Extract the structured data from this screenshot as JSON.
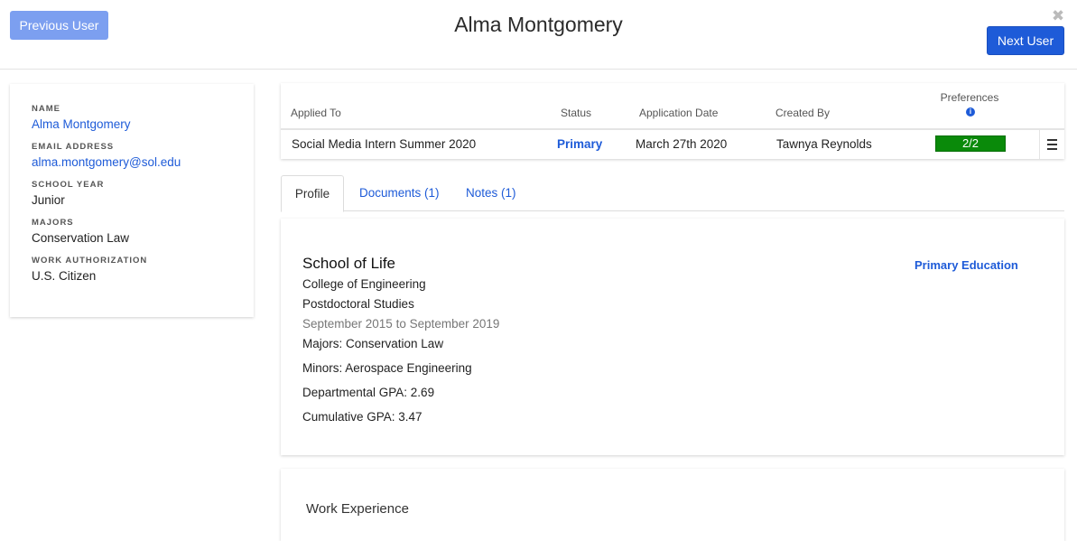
{
  "header": {
    "prev_label": "Previous User",
    "title": "Alma Montgomery",
    "close_glyph": "✖",
    "next_label": "Next User"
  },
  "sidebar": {
    "fields": [
      {
        "label": "NAME",
        "value": "Alma Montgomery",
        "is_link": true
      },
      {
        "label": "EMAIL ADDRESS",
        "value": "alma.montgomery@sol.edu",
        "is_link": true
      },
      {
        "label": "SCHOOL YEAR",
        "value": "Junior",
        "is_link": false
      },
      {
        "label": "MAJORS",
        "value": "Conservation Law",
        "is_link": false
      },
      {
        "label": "WORK AUTHORIZATION",
        "value": "U.S. Citizen",
        "is_link": false
      }
    ]
  },
  "applications": {
    "columns": {
      "applied_to": "Applied To",
      "status": "Status",
      "application_date": "Application Date",
      "created_by": "Created By",
      "preferences": "Preferences"
    },
    "row": {
      "applied_to": "Social Media Intern Summer 2020",
      "status": "Primary",
      "application_date": "March 27th 2020",
      "created_by": "Tawnya Reynolds",
      "preferences": "2/2"
    },
    "info_icon": "info-icon",
    "menu_icon": "hamburger-menu-icon"
  },
  "tabs": [
    {
      "label": "Profile",
      "active": true
    },
    {
      "label": "Documents (1)",
      "active": false
    },
    {
      "label": "Notes (1)",
      "active": false
    }
  ],
  "education": {
    "school": "School of Life",
    "tag": "Primary Education",
    "college": "College of Engineering",
    "degree": "Postdoctoral Studies",
    "dates": "September 2015 to September 2019",
    "majors": "Majors: Conservation Law",
    "minors": "Minors: Aerospace Engineering",
    "dept_gpa": "Departmental GPA: 2.69",
    "cum_gpa": "Cumulative GPA: 3.47"
  },
  "work": {
    "title": "Work Experience"
  },
  "colors": {
    "accent": "#1e5bd8",
    "prev_button": "#7c9ff0",
    "preference_bar": "#0a8a0a"
  }
}
